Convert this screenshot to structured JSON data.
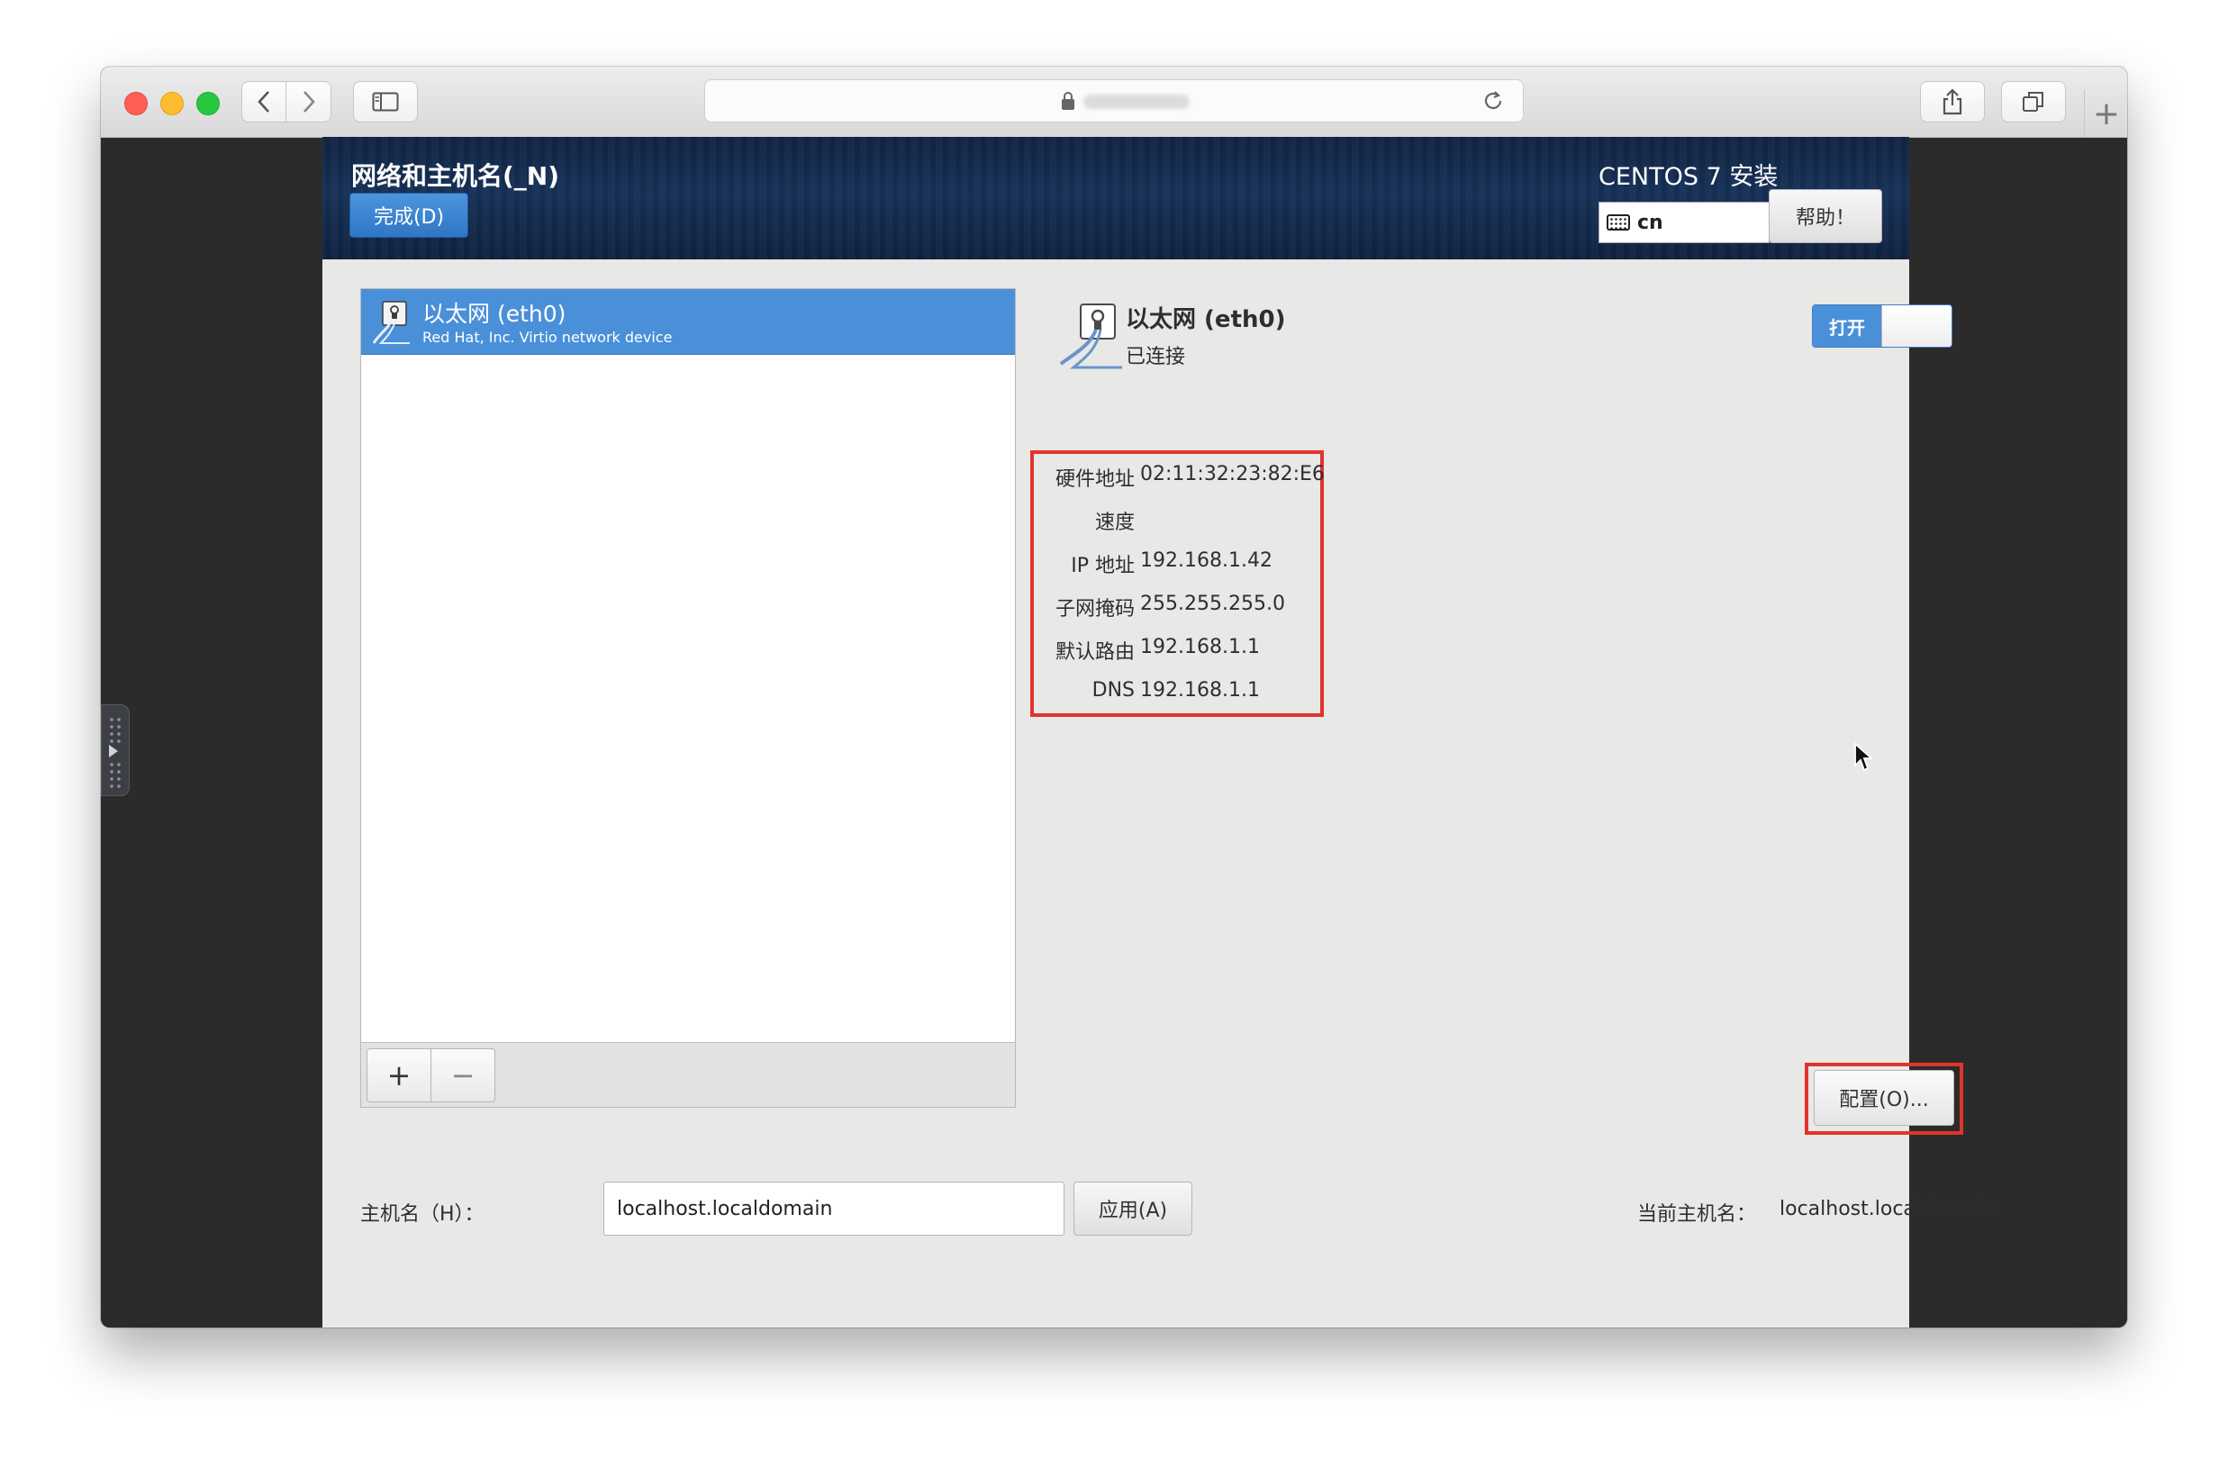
{
  "browser": {
    "back_icon": "chevron-left-icon",
    "forward_icon": "chevron-right-icon",
    "reload_icon": "reload-icon",
    "share_icon": "share-icon",
    "tabs_icon": "tabs-icon",
    "new_tab_label": "+"
  },
  "installer": {
    "page_title": "网络和主机名(_N)",
    "done_button": "完成(D)",
    "product_title": "CENTOS 7 安装",
    "keyboard_layout": "cn",
    "help_button": "帮助！"
  },
  "devices": [
    {
      "name": "以太网 (eth0)",
      "description": "Red Hat, Inc. Virtio network device",
      "selected": true
    }
  ],
  "list_buttons": {
    "add": "+",
    "remove": "−"
  },
  "detail": {
    "name": "以太网 (eth0)",
    "status": "已连接",
    "toggle_label": "打开",
    "toggle_on": true,
    "info": [
      {
        "label": "硬件地址",
        "value": "02:11:32:23:82:E6"
      },
      {
        "label": "速度",
        "value": ""
      },
      {
        "label": "IP 地址",
        "value": "192.168.1.42"
      },
      {
        "label": "子网掩码",
        "value": "255.255.255.0"
      },
      {
        "label": "默认路由",
        "value": "192.168.1.1"
      },
      {
        "label": "DNS",
        "value": "192.168.1.1"
      }
    ],
    "config_button": "配置(O)..."
  },
  "hostname": {
    "label": "主机名（H）：",
    "value": "localhost.localdomain",
    "apply_button": "应用(A)",
    "current_label": "当前主机名：",
    "current_value": "localhost.localdomain"
  },
  "colors": {
    "accent_blue": "#4a90d9",
    "highlight_red": "#e1342c",
    "header_navy": "#173158"
  }
}
